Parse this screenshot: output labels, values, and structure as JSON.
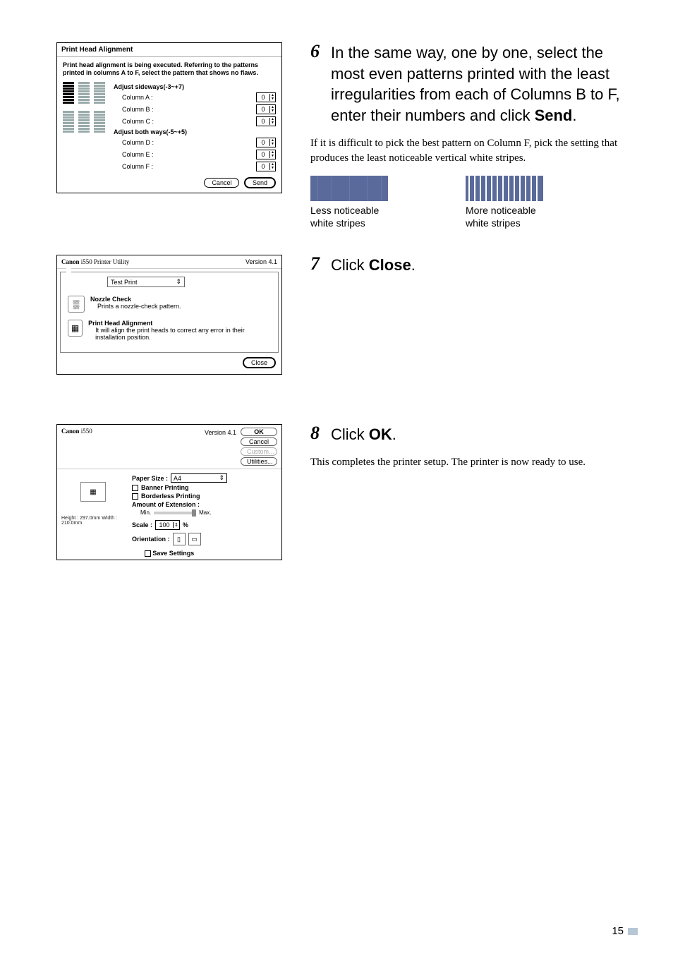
{
  "step6": {
    "num": "6",
    "text_a": "In the same way, one by one, select the most even patterns printed with the least irregularities from each of Columns B to F, enter their numbers and click ",
    "text_b": "Send",
    "text_c": ".",
    "sub": "If it is difficult to pick the best pattern on Column F, pick the setting that produces the least noticeable vertical white stripes.",
    "swatch_less": "Less noticeable white stripes",
    "swatch_more": "More noticeable white stripes"
  },
  "step7": {
    "num": "7",
    "text_a": "Click ",
    "text_b": "Close",
    "text_c": "."
  },
  "step8": {
    "num": "8",
    "text_a": "Click ",
    "text_b": "OK",
    "text_c": ".",
    "sub": "This completes the printer setup. The printer is now ready to use."
  },
  "dialog1": {
    "title": "Print Head Alignment",
    "msg": "Print head alignment is being executed. Referring to the patterns printed in columns A to F, select the pattern that shows no flaws.",
    "sect1": "Adjust sideways(-3~+7)",
    "colA": "Column A :",
    "colB": "Column B :",
    "colC": "Column C :",
    "sect2": "Adjust both ways(-5~+5)",
    "colD": "Column D :",
    "colE": "Column E :",
    "colF": "Column F :",
    "valA": "0",
    "valB": "0",
    "valC": "0",
    "valD": "0",
    "valE": "0",
    "valF": "0",
    "cancel": "Cancel",
    "send": "Send"
  },
  "dialog2": {
    "brand": "Canon",
    "model": " i550 Printer Utility",
    "version": "Version 4.1",
    "tab": "Test Print",
    "noz_t": "Nozzle Check",
    "noz_d": "Prints a nozzle-check pattern.",
    "pha_t": "Print Head Alignment",
    "pha_d": "It will align the print heads to correct any error in their installation position.",
    "close": "Close"
  },
  "dialog3": {
    "brand": "Canon",
    "model": " i550",
    "version": "Version 4.1",
    "ok": "OK",
    "cancel": "Cancel",
    "custom": "Custom...",
    "util": "Utilities...",
    "paper": "Paper Size :",
    "paperv": "A4",
    "banner": "Banner Printing",
    "borderless": "Borderless Printing",
    "amount": "Amount of Extension :",
    "min": "Min.",
    "max": "Max.",
    "scale": "Scale :",
    "scalev": "100",
    "pct": "%",
    "orient": "Orientation :",
    "save": "Save Settings",
    "dims": "Height : 297.0mm    Width : 210.0mm"
  },
  "page_number": "15"
}
